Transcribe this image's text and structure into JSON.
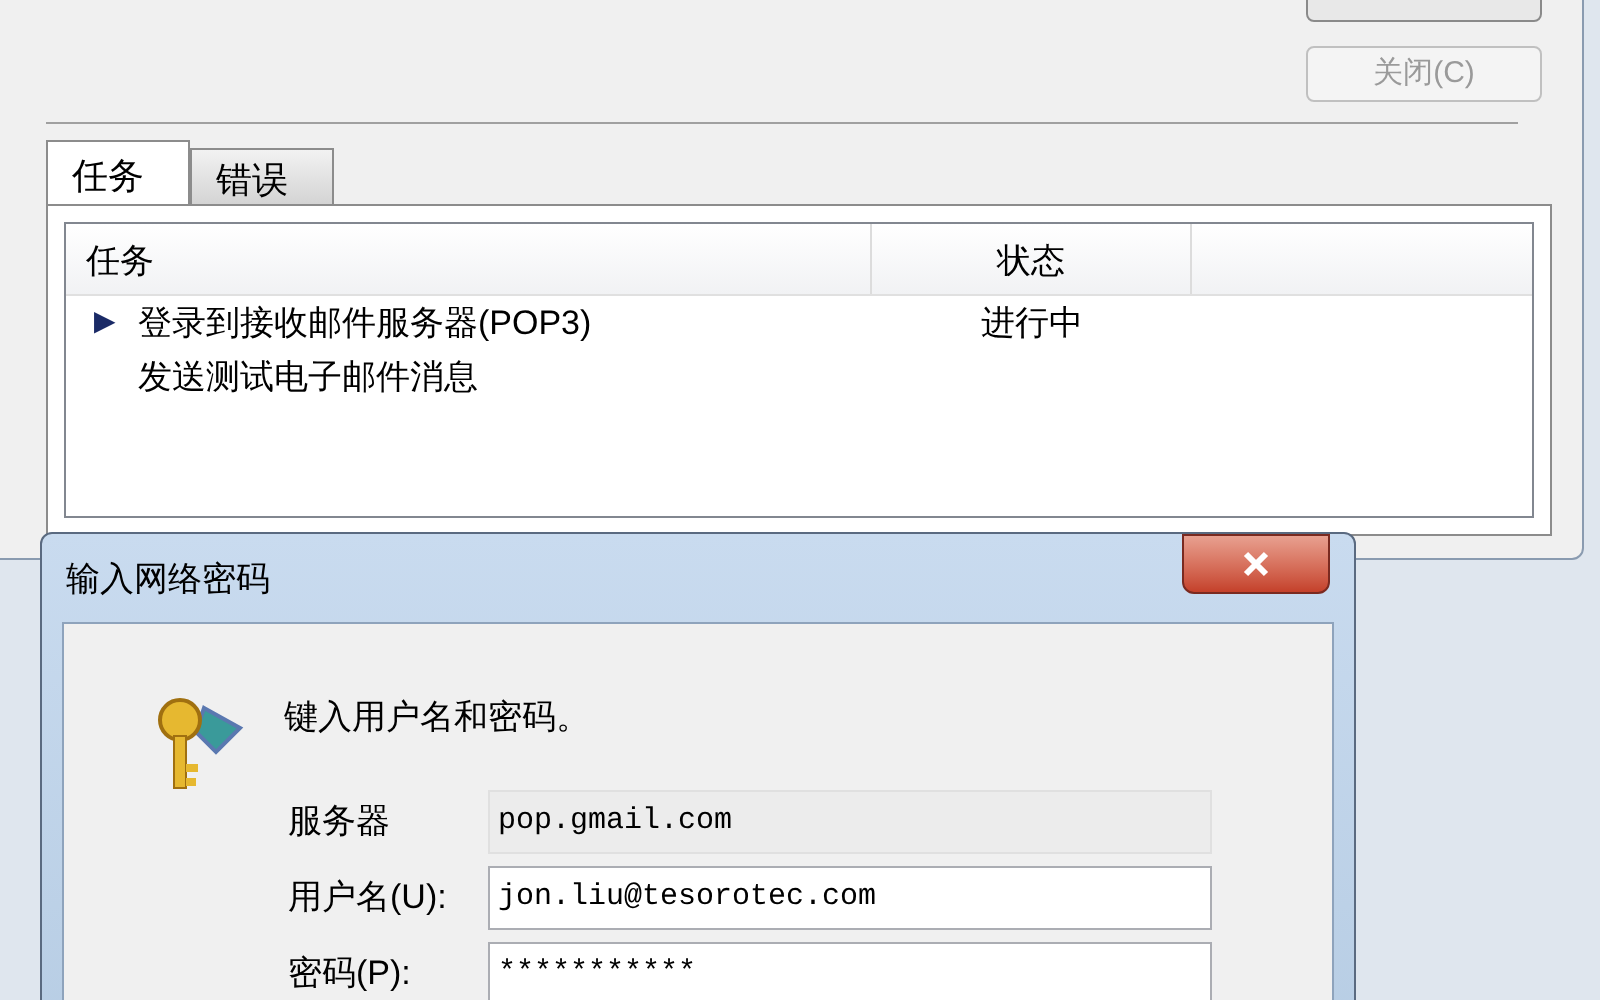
{
  "main_dialog": {
    "close_button": {
      "label": "关闭(C)",
      "disabled": true
    },
    "tabs": [
      {
        "label": "任务",
        "selected": true
      },
      {
        "label": "错误",
        "selected": false
      }
    ],
    "table": {
      "columns": [
        "任务",
        "状态"
      ],
      "rows": [
        {
          "task": "登录到接收邮件服务器(POP3)",
          "status": "进行中",
          "marker": "▶"
        },
        {
          "task": "发送测试电子邮件消息"
        }
      ]
    }
  },
  "password_dialog": {
    "title": "输入网络密码",
    "prompt": "键入用户名和密码。",
    "fields": [
      {
        "label": "服务器",
        "value": "pop.gmail.com",
        "readonly": true
      },
      {
        "label": "用户名(U):",
        "value": "jon.liu@tesorotec.com",
        "readonly": false
      },
      {
        "label": "密码(P):",
        "value": "***********",
        "readonly": false
      }
    ]
  }
}
